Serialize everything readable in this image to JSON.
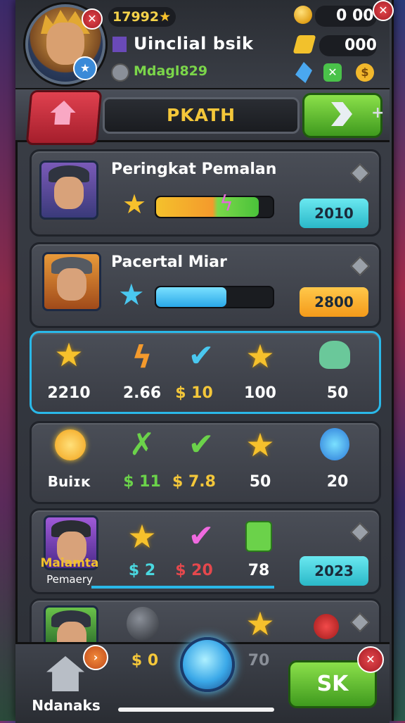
{
  "header": {
    "score": "17992",
    "player_name": "Uinclial bsik",
    "player_id": "Mdagl829",
    "coins": "0 00",
    "gems": "000"
  },
  "nav": {
    "title": "PKATH"
  },
  "cards": {
    "rank": {
      "title": "Peringkat Pemalan",
      "value": "2010",
      "progress": 0.88
    },
    "pacertal": {
      "title": "Pacertal Miar",
      "value": "2800",
      "progress": 0.6
    }
  },
  "stats_row1": [
    "2210",
    "2.66",
    "$ 10",
    "100",
    "50"
  ],
  "stats_row2": [
    "Buiɪĸ",
    "$ 11",
    "$ 7.8",
    "50",
    "20"
  ],
  "stats_row3": {
    "portrait_title": "Maiamta",
    "portrait_sub": "Pemaery",
    "values": [
      "$ 2",
      "$ 20",
      "78"
    ],
    "badge": "2023"
  },
  "bottom": {
    "home_label": "Ndanaks",
    "coin_value": "$ 0",
    "value2": "70",
    "action_label": "SK"
  }
}
